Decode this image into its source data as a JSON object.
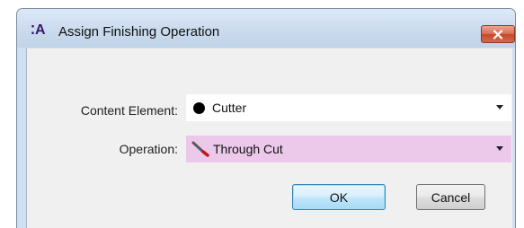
{
  "window": {
    "icon_text": "A",
    "title": "Assign Finishing Operation"
  },
  "form": {
    "content_element": {
      "label": "Content Element:",
      "value": "Cutter",
      "color": "#000000"
    },
    "operation": {
      "label": "Operation:",
      "value": "Through Cut",
      "highlight_color": "#ecc9ea",
      "icon": "knife-icon"
    }
  },
  "buttons": {
    "ok": "OK",
    "cancel": "Cancel"
  }
}
